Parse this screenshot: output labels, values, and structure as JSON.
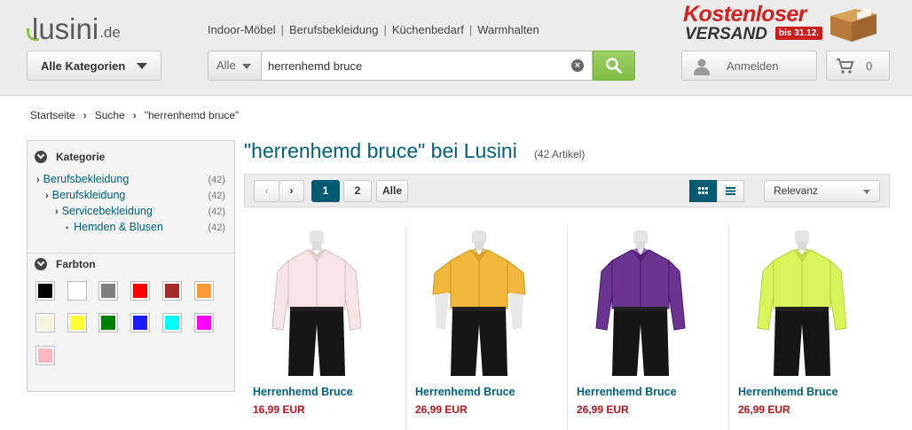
{
  "header": {
    "logo_text": "lusini",
    "logo_tld": ".de",
    "nav": [
      "Indoor-Möbel",
      "Berufsbekleidung",
      "Küchenbedarf",
      "Warmhalten"
    ],
    "promo": {
      "line1": "Kostenloser",
      "line2": "VERSAND",
      "badge": "bis 31.12."
    },
    "category_button": "Alle Kategorien",
    "search": {
      "scope": "Alle",
      "value": "herrenhemd bruce"
    },
    "login_label": "Anmelden",
    "cart_count": "0"
  },
  "breadcrumb": [
    "Startseite",
    "Suche",
    "\"herrenhemd bruce\""
  ],
  "sidebar": {
    "category_title": "Kategorie",
    "categories": [
      {
        "label": "Berufsbekleidung",
        "count": "(42)"
      },
      {
        "label": "Berufskleidung",
        "count": "(42)"
      },
      {
        "label": "Servicebekleidung",
        "count": "(42)"
      },
      {
        "label": "Hemden & Blusen",
        "count": "(42)"
      }
    ],
    "color_title": "Farbton",
    "colors": [
      "#000000",
      "#ffffff",
      "#7f7f7f",
      "#ff0000",
      "#a52a2a",
      "#ff9933",
      "#f5f5dc",
      "#ffff33",
      "#008000",
      "#1a1aff",
      "#00ffff",
      "#ff00ff",
      "#ffb6c1"
    ]
  },
  "results": {
    "title": "\"herrenhemd bruce\" bei Lusini",
    "count": "(42 Artikel)",
    "pages": [
      "1",
      "2",
      "Alle"
    ],
    "sort": "Relevanz"
  },
  "products": [
    {
      "name": "Herrenhemd Bruce",
      "price": "16,99 EUR",
      "shirt_color": "#f6e4e6"
    },
    {
      "name": "Herrenhemd Bruce",
      "price": "26,99 EUR",
      "shirt_color": "#f1b83b"
    },
    {
      "name": "Herrenhemd Bruce",
      "price": "26,99 EUR",
      "shirt_color": "#6a3590"
    },
    {
      "name": "Herrenhemd Bruce",
      "price": "26,99 EUR",
      "shirt_color": "#d8f55a"
    }
  ]
}
